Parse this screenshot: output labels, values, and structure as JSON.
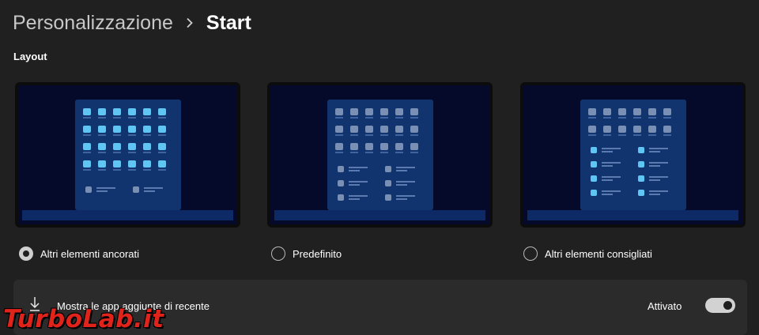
{
  "breadcrumb": {
    "parent": "Personalizzazione",
    "separator": "›",
    "current": "Start"
  },
  "section": {
    "label": "Layout"
  },
  "layouts": [
    {
      "label": "Altri elementi ancorati",
      "selected": true
    },
    {
      "label": "Predefinito",
      "selected": false
    },
    {
      "label": "Altri elementi consigliati",
      "selected": false
    }
  ],
  "setting": {
    "icon": "download-arrow-icon",
    "label": "Mostra le app aggiunte di recente",
    "state_label": "Attivato",
    "toggle_on": true
  },
  "watermark": {
    "text": "TurboLab.it"
  },
  "colors": {
    "background": "#202020",
    "card_surface": "#2b2b2b",
    "preview_screen": "#050a2a",
    "preview_menu": "#11346e",
    "tile_accent": "#5fc6f3",
    "watermark": "#e0241b"
  }
}
